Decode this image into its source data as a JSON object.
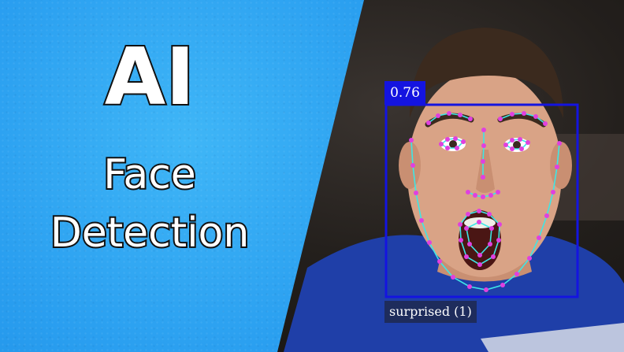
{
  "heading": {
    "line1": "AI",
    "line2": "Face",
    "line3": "Detection"
  },
  "detection": {
    "score": "0.76",
    "expression": "surprised (1)"
  },
  "colors": {
    "panel_blue": "#2a9ff0",
    "box_blue": "#1414e0",
    "landmark_line": "#3ee6e6",
    "landmark_point": "#e040e0"
  }
}
